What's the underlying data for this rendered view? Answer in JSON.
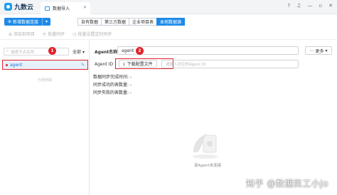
{
  "app": {
    "logo_text": "九数云",
    "tab_title": "数据导入"
  },
  "window_icons": [
    "minimize-icon",
    "restore-icon",
    "close-icon"
  ],
  "toolbar": {
    "new_connection": "新增数据连接",
    "segments": [
      "自有数据",
      "第三方数据",
      "企业项目表",
      "本地数据源"
    ],
    "active_segment": "本地数据源"
  },
  "actions": [
    "添加到项目",
    "批量同步",
    "批量设置定时同步"
  ],
  "left": {
    "search_placeholder": "搜索节点名称",
    "filter_label": "全部",
    "agent_item": "agent",
    "footer": "已经到底"
  },
  "right": {
    "agent_name_label": "Agent名称",
    "agent_name_value": "agent",
    "more_button": "更多",
    "agent_id_label": "Agent ID",
    "download_button": "下载配置文件",
    "agent_id_placeholder": "请输入对应的Agent ID",
    "stats": [
      {
        "label": "数据同步完成时间:",
        "value": "-"
      },
      {
        "label": "同步成功的表数量:",
        "value": "-"
      },
      {
        "label": "同步失败的表数量:",
        "value": "-"
      }
    ],
    "empty_text": "该Agent未连接"
  },
  "annotations": [
    "1",
    "2"
  ],
  "watermark": "知乎 @数据民工小jo",
  "colors": {
    "accent": "#1e8ae8",
    "highlight": "#e3212b"
  }
}
